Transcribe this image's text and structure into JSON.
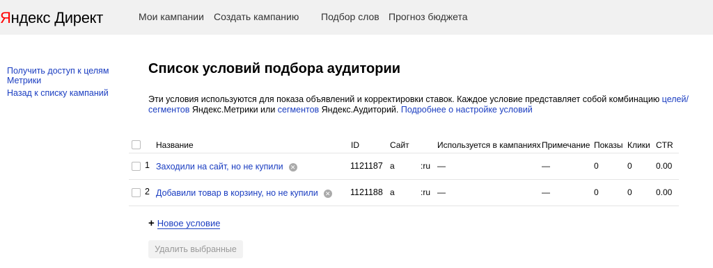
{
  "header": {
    "logo_ya": "Я",
    "logo_rest": "ндекс",
    "logo_product": "Директ",
    "nav": [
      "Мои кампании",
      "Создать кампанию",
      "Подбор слов",
      "Прогноз бюджета"
    ]
  },
  "sidebar": {
    "links": [
      "Получить доступ к целям Метрики",
      "Назад к списку кампаний"
    ]
  },
  "main": {
    "title": "Список условий подбора аудитории",
    "desc_part1": "Эти условия используются для показа объявлений и корректировки ставок. Каждое условие представляет собой комбинацию ",
    "desc_link1": "целей/сегментов",
    "desc_part2": " Яндекс.Метрики или ",
    "desc_link2": "сегментов",
    "desc_part3": " Яндекс.Аудиторий. ",
    "desc_link3": "Подробнее о настройке условий"
  },
  "table": {
    "columns": [
      "Название",
      "ID",
      "Сайт",
      "Используется в кампаниях",
      "Примечание",
      "Показы",
      "Клики",
      "CTR"
    ],
    "rows": [
      {
        "num": "1",
        "name": "Заходили на сайт, но не купили",
        "id": "1121187",
        "site_a": "a",
        "site_b": ":ru",
        "used": "—",
        "note": "—",
        "shows": "0",
        "clicks": "0",
        "ctr": "0.00"
      },
      {
        "num": "2",
        "name": "Добавили товар в корзину, но не купили",
        "id": "1121188",
        "site_a": "a",
        "site_b": ":ru",
        "used": "—",
        "note": "—",
        "shows": "0",
        "clicks": "0",
        "ctr": "0.00"
      }
    ]
  },
  "actions": {
    "new_condition": "Новое условие",
    "plus": "+",
    "delete_selected": "Удалить выбранные"
  },
  "icons": {
    "remove": "remove-icon"
  },
  "colors": {
    "link": "#1a3dc1",
    "logo_red": "#ff0000",
    "header_bg": "#f1f1f1"
  }
}
